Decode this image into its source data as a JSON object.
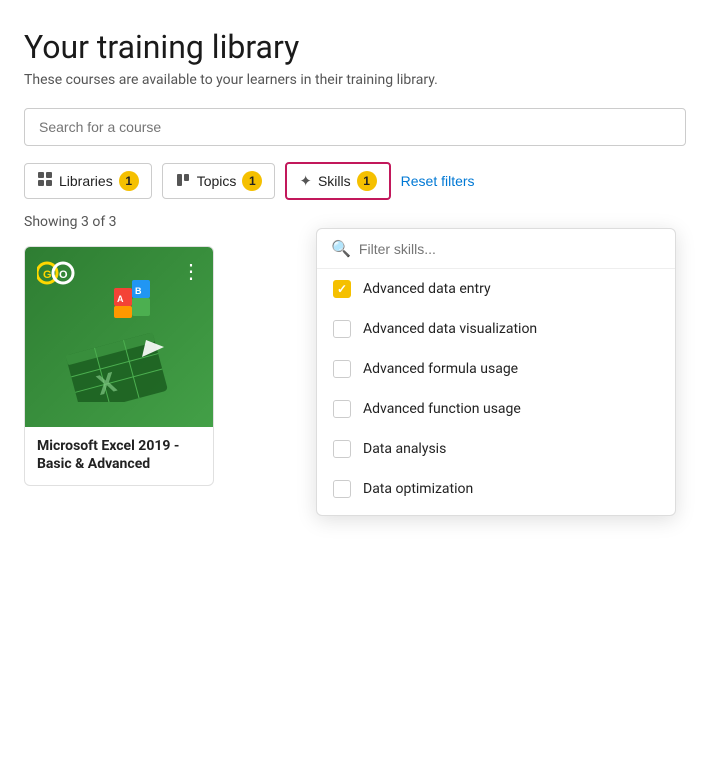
{
  "page": {
    "title": "Your training library",
    "subtitle": "These courses are available to your learners in their training library."
  },
  "search": {
    "placeholder": "Search for a course"
  },
  "filters": {
    "libraries": {
      "label": "Libraries",
      "count": "1"
    },
    "topics": {
      "label": "Topics",
      "count": "1"
    },
    "skills": {
      "label": "Skills",
      "count": "1"
    },
    "reset": "Reset filters"
  },
  "showing": "Showing 3 of 3",
  "skills_dropdown": {
    "search_placeholder": "Filter skills...",
    "items": [
      {
        "label": "Advanced data entry",
        "checked": true
      },
      {
        "label": "Advanced data visualization",
        "checked": false
      },
      {
        "label": "Advanced formula usage",
        "checked": false
      },
      {
        "label": "Advanced function usage",
        "checked": false
      },
      {
        "label": "Data analysis",
        "checked": false
      },
      {
        "label": "Data optimization",
        "checked": false
      }
    ]
  },
  "course": {
    "title": "Microsoft Excel 2019 - Basic & Advanced"
  }
}
